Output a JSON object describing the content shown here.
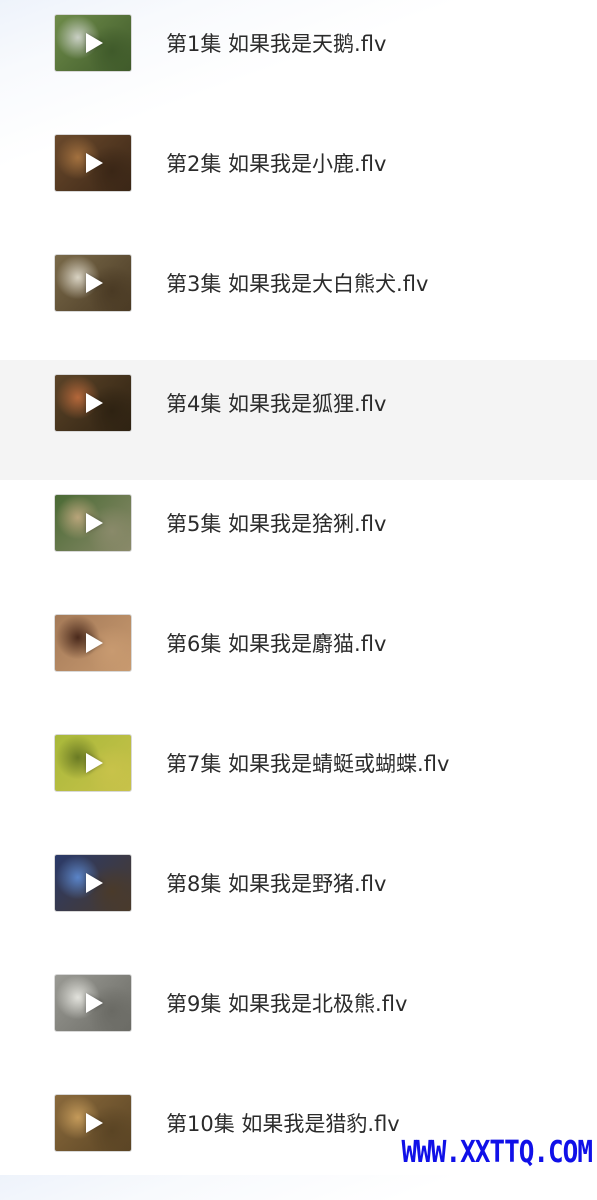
{
  "files": [
    {
      "name": "第1集 如果我是天鹅.flv",
      "thumb_colors": [
        "#6f8c4a",
        "#c9cfc4",
        "#3f5a2a"
      ],
      "hovered": false
    },
    {
      "name": "第2集 如果我是小鹿.flv",
      "thumb_colors": [
        "#6b4a2c",
        "#a3713f",
        "#3a2616"
      ],
      "hovered": false
    },
    {
      "name": "第3集 如果我是大白熊犬.flv",
      "thumb_colors": [
        "#7a6a4a",
        "#d8d2c2",
        "#4a3a24"
      ],
      "hovered": false
    },
    {
      "name": "第4集 如果我是狐狸.flv",
      "thumb_colors": [
        "#5c4428",
        "#b4673a",
        "#2e2212"
      ],
      "hovered": true
    },
    {
      "name": "第5集 如果我是猞猁.flv",
      "thumb_colors": [
        "#4a6a34",
        "#b8a47a",
        "#8a8a6a"
      ],
      "hovered": false
    },
    {
      "name": "第6集 如果我是麝猫.flv",
      "thumb_colors": [
        "#a47a58",
        "#4a2a1c",
        "#c89a70"
      ],
      "hovered": false
    },
    {
      "name": "第7集 如果我是蜻蜓或蝴蝶.flv",
      "thumb_colors": [
        "#a8b83a",
        "#6a7a24",
        "#c8c24a"
      ],
      "hovered": false
    },
    {
      "name": "第8集 如果我是野猪.flv",
      "thumb_colors": [
        "#2a3a6a",
        "#5a84c8",
        "#4a3a2a"
      ],
      "hovered": false
    },
    {
      "name": "第9集 如果我是北极熊.flv",
      "thumb_colors": [
        "#9a9a94",
        "#e2e2dc",
        "#6a6a64"
      ],
      "hovered": false
    },
    {
      "name": "第10集 如果我是猎豹.flv",
      "thumb_colors": [
        "#8a6a3c",
        "#c49a5a",
        "#5a4424"
      ],
      "hovered": false
    }
  ],
  "watermark": "WWW.XXTTQ.COM",
  "icons": {
    "play": "play-icon"
  }
}
